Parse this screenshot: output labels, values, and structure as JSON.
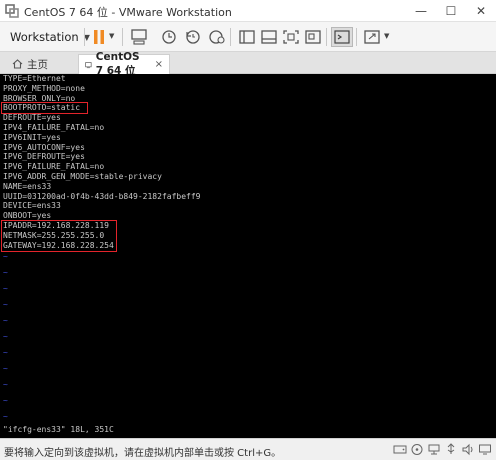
{
  "window": {
    "title": "CentOS 7 64 位 - VMware Workstation",
    "minimize_glyph": "—",
    "maximize_glyph": "☐",
    "close_glyph": "✕"
  },
  "toolbar": {
    "menu_label": "Workstation",
    "caret": "▼"
  },
  "tabs": [
    {
      "label": "主页",
      "icon": "home-icon"
    },
    {
      "label": "CentOS 7 64 位",
      "icon": "vm-icon",
      "close": "×"
    }
  ],
  "console": {
    "lines": [
      "TYPE=Ethernet",
      "PROXY_METHOD=none",
      "BROWSER_ONLY=no",
      "BOOTPROTO=static",
      "DEFROUTE=yes",
      "IPV4_FAILURE_FATAL=no",
      "IPV6INIT=yes",
      "IPV6_AUTOCONF=yes",
      "IPV6_DEFROUTE=yes",
      "IPV6_FAILURE_FATAL=no",
      "IPV6_ADDR_GEN_MODE=stable-privacy",
      "NAME=ens33",
      "UUID=031200ad-0f4b-43dd-b849-2182fafbeff9",
      "DEVICE=ens33",
      "ONBOOT=yes",
      "IPADDR=192.168.228.119",
      "NETMASK=255.255.255.0",
      "GATEWAY=192.168.228.254"
    ],
    "tilde": "~",
    "status_line": "\"ifcfg-ens33\" 18L, 351C"
  },
  "statusbar": {
    "message": "要将输入定向到该虚拟机，请在虚拟机内部单击或按 Ctrl+G。"
  },
  "colors": {
    "console_bg": "#000000",
    "console_text": "#c8c8c8",
    "tilde": "#3f4fd8",
    "highlight": "#e3242b",
    "pause_orange": "#f08a24"
  }
}
